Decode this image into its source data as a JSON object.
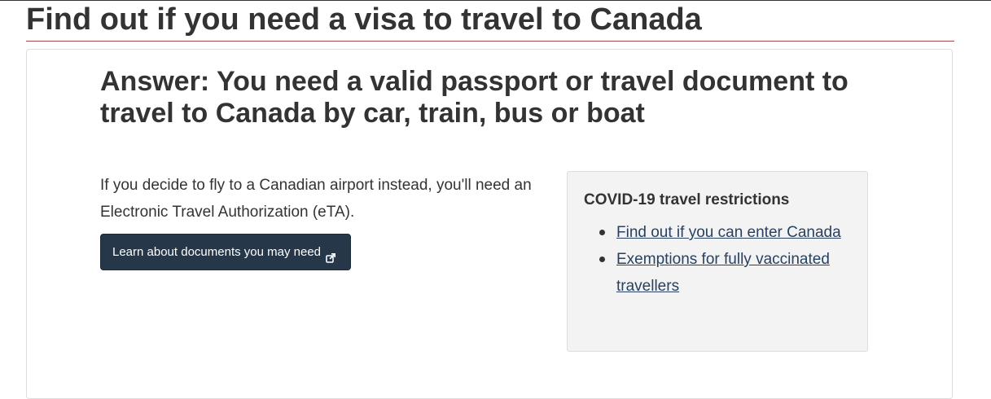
{
  "page": {
    "title": "Find out if you need a visa to travel to Canada"
  },
  "answer": {
    "heading": "Answer: You need a valid passport or travel document to travel to Canada by car, train, bus or boat",
    "intro": "If you decide to fly to a Canadian airport instead, you'll need an Electronic Travel Authorization (eTA).",
    "button_label": "Learn about documents you may need",
    "button_icon": "external-link-icon"
  },
  "covid": {
    "title": "COVID-19 travel restrictions",
    "links": [
      {
        "label": "Find out if you can enter Canada"
      },
      {
        "label": "Exemptions for fully vaccinated travellers"
      }
    ]
  },
  "colors": {
    "button_bg": "#26374a",
    "link": "#284162",
    "title_rule": "#a34848",
    "box_bg": "#f3f3f3"
  }
}
